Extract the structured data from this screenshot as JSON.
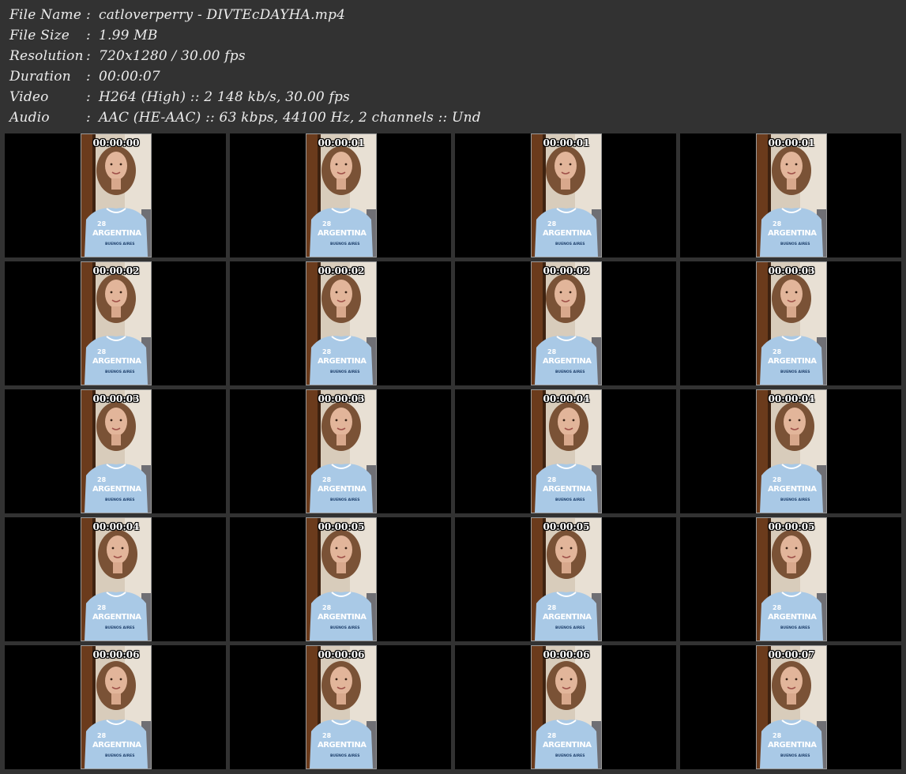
{
  "info": [
    {
      "key": "File Name",
      "value": "catloverperry - DIVTEcDAYHA.mp4"
    },
    {
      "key": "File Size",
      "value": "1.99 MB"
    },
    {
      "key": "Resolution",
      "value": "720x1280 / 30.00 fps"
    },
    {
      "key": "Duration",
      "value": "00:00:07"
    },
    {
      "key": "Video",
      "value": "H264 (High) :: 2 148 kb/s, 30.00 fps"
    },
    {
      "key": "Audio",
      "value": "AAC (HE-AAC) :: 63 kbps, 44100 Hz, 2 channels :: Und"
    }
  ],
  "separator": ":",
  "thumbnails": [
    "00:00:00",
    "00:00:01",
    "00:00:01",
    "00:00:01",
    "00:00:02",
    "00:00:02",
    "00:00:02",
    "00:00:03",
    "00:00:03",
    "00:00:03",
    "00:00:04",
    "00:00:04",
    "00:00:04",
    "00:00:05",
    "00:00:05",
    "00:00:05",
    "00:00:06",
    "00:00:06",
    "00:00:06",
    "00:00:07"
  ],
  "shirt_print": {
    "number": "28",
    "word": "ARGENTINA",
    "sub": "BUENOS AIRES"
  },
  "colors": {
    "background": "#323232",
    "cell": "#000000",
    "text": "#ececec",
    "shirt": "#a9c9e6",
    "wall": "#d8ccbb",
    "door": "#6b3b1c",
    "hair": "#7a5236",
    "skin": "#e2b59a"
  }
}
